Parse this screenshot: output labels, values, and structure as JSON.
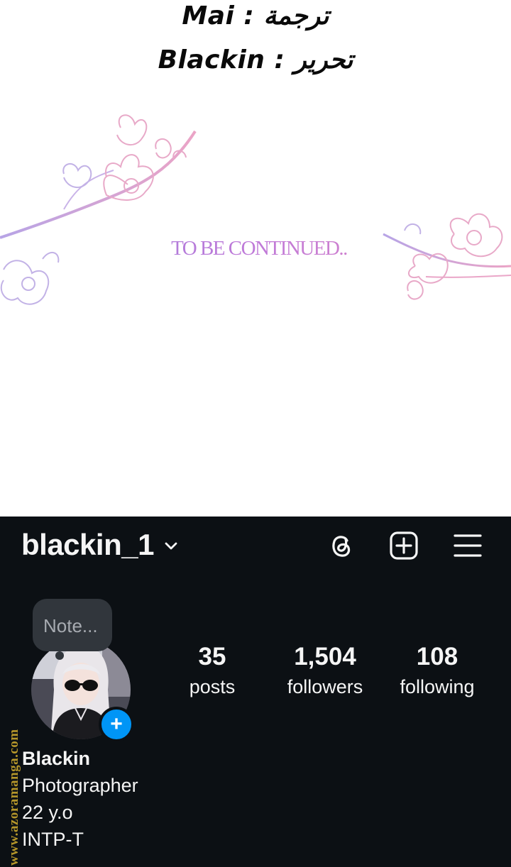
{
  "credits": {
    "line1": "Mai : ترجمة",
    "line2": "Blackin : تحرير"
  },
  "story": {
    "caption": "TO BE CONTINUED.."
  },
  "profile": {
    "username": "blackin_1",
    "note_placeholder": "Note...",
    "add_story_symbol": "+",
    "stats": [
      {
        "value": "35",
        "label": "posts"
      },
      {
        "value": "1,504",
        "label": "followers"
      },
      {
        "value": "108",
        "label": "following"
      }
    ],
    "bio": {
      "name": "Blackin",
      "lines": [
        "Photographer",
        "22 y.o",
        "INTP-T"
      ]
    },
    "icons": {
      "header_left": "chevron-down-icon",
      "header_right": [
        "threads-icon",
        "create-post-icon",
        "menu-icon"
      ]
    },
    "colors": {
      "background": "#0c1014",
      "accent": "#0095f6",
      "note_bubble": "#31363c"
    }
  },
  "watermark": "www.azoramanga.com"
}
